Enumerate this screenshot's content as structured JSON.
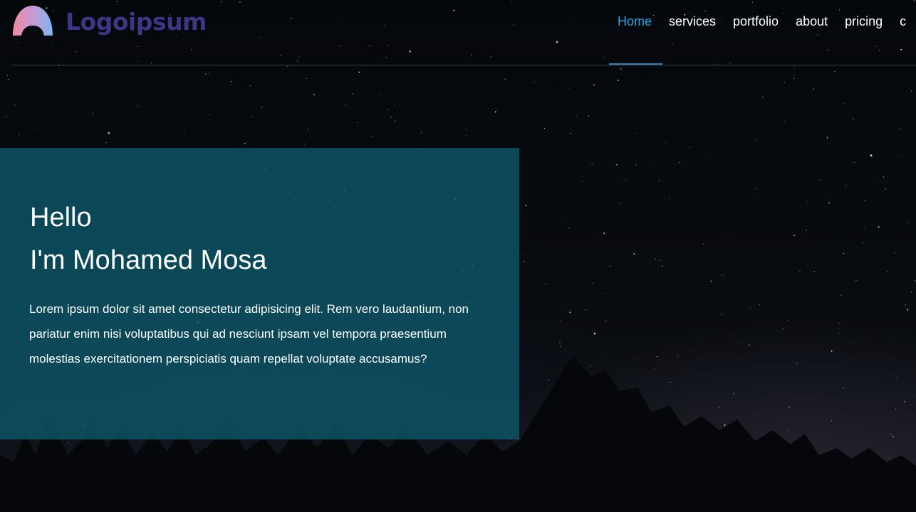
{
  "header": {
    "logo_text": "Logoipsum",
    "nav": [
      {
        "label": "Home",
        "active": true
      },
      {
        "label": "services",
        "active": false
      },
      {
        "label": "portfolio",
        "active": false
      },
      {
        "label": "about",
        "active": false
      },
      {
        "label": "pricing",
        "active": false
      },
      {
        "label": "c",
        "active": false
      }
    ]
  },
  "hero": {
    "greeting_line1": "Hello",
    "greeting_line2": "I'm Mohamed Mosa",
    "description": "Lorem ipsum dolor sit amet consectetur adipisicing elit. Rem vero laudantium, non pariatur enim nisi voluptatibus qui ad nesciunt ipsam vel tempora praesentium molestias exercitationem perspiciatis quam repellat voluptate accusamus?"
  },
  "colors": {
    "accent": "#27a6df",
    "hero_box": "#0c5668",
    "logo_text": "#3f3585",
    "logo_gradient": [
      "#f08aa0",
      "#7fb6f0"
    ]
  },
  "icons": [
    "logo-mark-icon"
  ]
}
